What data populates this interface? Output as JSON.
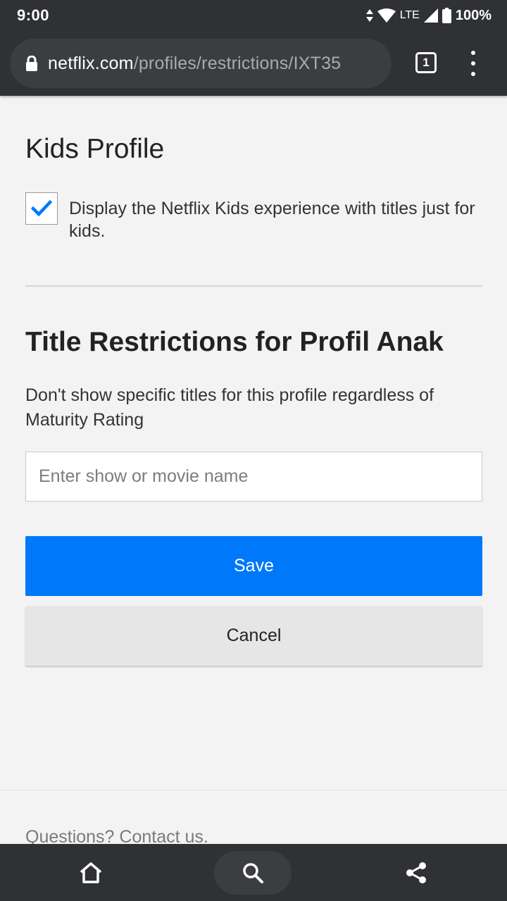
{
  "status_bar": {
    "time": "9:00",
    "network": "LTE",
    "battery": "100%"
  },
  "browser": {
    "url_host": "netflix.com",
    "url_path": "/profiles/restrictions/IXT35",
    "tab_count": "1"
  },
  "kids_section": {
    "title": "Kids Profile",
    "checkbox_checked": true,
    "description": "Display the Netflix Kids experience with titles just for kids."
  },
  "restrictions": {
    "title": "Title Restrictions for Profil Anak",
    "description": "Don't show specific titles for this profile regardless of Maturity Rating",
    "search_placeholder": "Enter show or movie name",
    "save_label": "Save",
    "cancel_label": "Cancel"
  },
  "footer": {
    "contact_text": "Questions? Contact us."
  },
  "colors": {
    "accent": "#0078fa",
    "chrome": "#303134",
    "page_background": "#f3f3f3"
  },
  "icons": [
    "data-saver-icon",
    "wifi-icon",
    "signal-icon",
    "battery-icon",
    "lock-icon",
    "more-vert-icon",
    "check-icon",
    "home-icon",
    "search-icon",
    "share-icon"
  ]
}
